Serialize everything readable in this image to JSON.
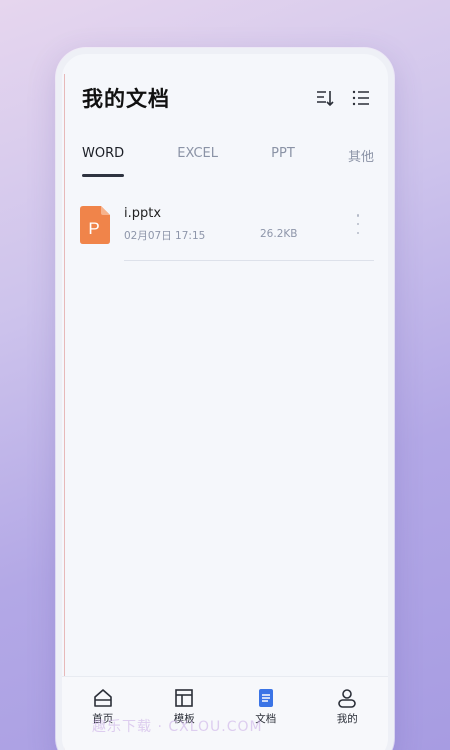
{
  "header": {
    "title": "我的文档",
    "sort_icon": "sort-down-icon",
    "list_icon": "list-view-icon"
  },
  "tabs": [
    {
      "label": "WORD",
      "active": true
    },
    {
      "label": "EXCEL",
      "active": false
    },
    {
      "label": "PPT",
      "active": false
    },
    {
      "label": "其他",
      "active": false
    }
  ],
  "files": [
    {
      "name": "i.pptx",
      "date": "02月07日 17:15",
      "size": "26.2KB",
      "icon_letter": "P",
      "icon_color": "#f0844a"
    }
  ],
  "bottom_nav": [
    {
      "label": "首页",
      "icon": "home-icon",
      "active": false
    },
    {
      "label": "模板",
      "icon": "template-icon",
      "active": false
    },
    {
      "label": "文档",
      "icon": "document-icon",
      "active": true
    },
    {
      "label": "我的",
      "icon": "profile-icon",
      "active": false
    }
  ],
  "colors": {
    "accent": "#3b74e6",
    "ppt_orange": "#f0844a"
  },
  "watermark": "趣乐下载 · CXLOU.COM"
}
